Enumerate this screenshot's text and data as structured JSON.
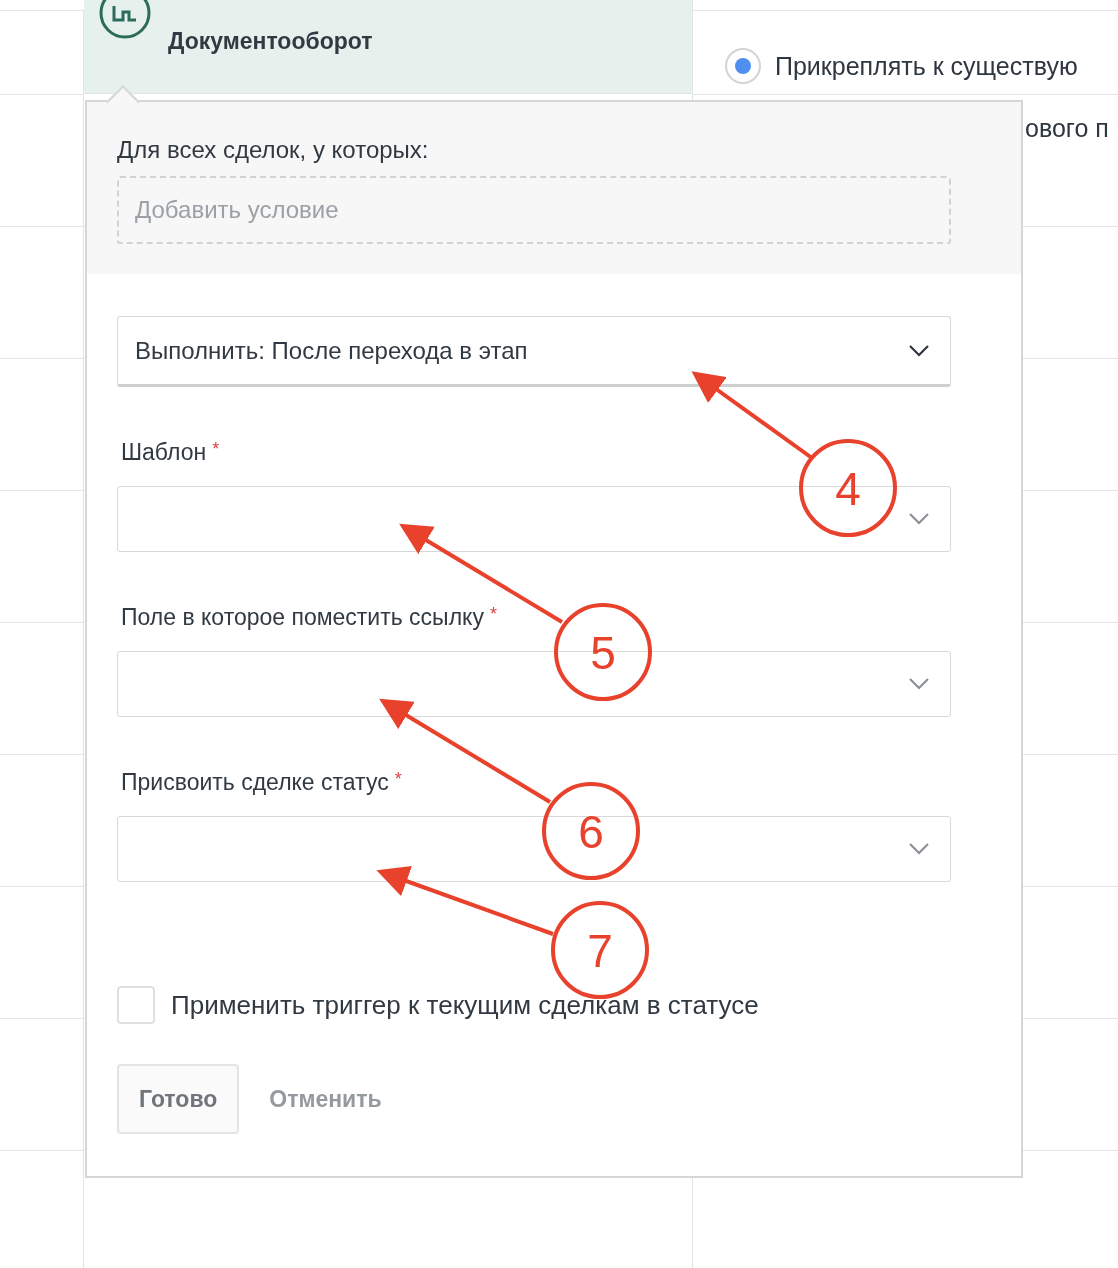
{
  "card": {
    "title": "Документооборот"
  },
  "options": [
    {
      "label": "Прикреплять к существую",
      "selected": true
    }
  ],
  "covered_option": {
    "label": "ового п"
  },
  "popup": {
    "condition_label": "Для всех сделок, у которых:",
    "condition_placeholder": "Добавить условие",
    "execute": {
      "value": "Выполнить: После перехода в этап"
    },
    "fields": [
      {
        "label": "Шаблон",
        "required_mark": "*"
      },
      {
        "label": "Поле в которое поместить ссылку",
        "required_mark": "*"
      },
      {
        "label": "Присвоить сделке статус",
        "required_mark": "*"
      }
    ],
    "apply_checkbox": {
      "label": "Применить триггер к текущим сделкам в статусе",
      "checked": false
    },
    "buttons": [
      {
        "label": "Готово",
        "kind": "primary"
      },
      {
        "label": "Отменить",
        "kind": "link"
      }
    ]
  },
  "annotations": [
    {
      "number": "4"
    },
    {
      "number": "5"
    },
    {
      "number": "6"
    },
    {
      "number": "7"
    }
  ]
}
